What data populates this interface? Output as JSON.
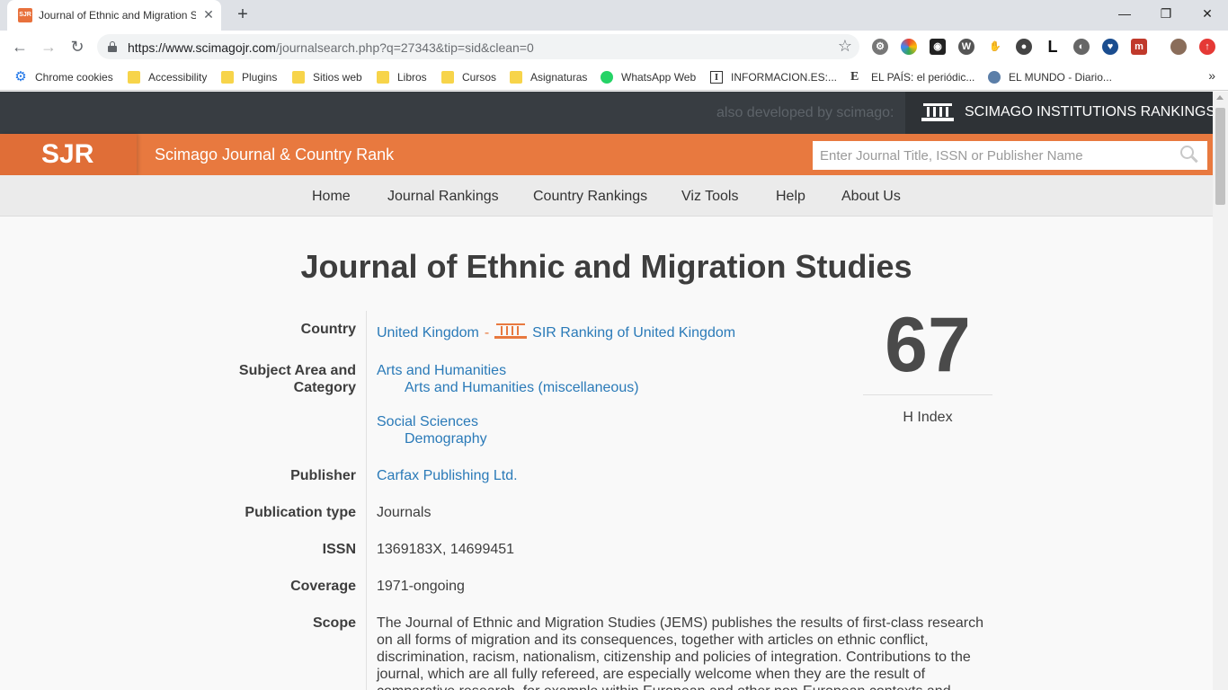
{
  "browser": {
    "tab_title": "Journal of Ethnic and Migration S",
    "tab_favicon": "SJR",
    "url_host": "https://www.scimagojr.com",
    "url_path": "/journalsearch.php?q=27343&tip=sid&clean=0",
    "bookmarks": [
      {
        "label": "Chrome cookies",
        "icon": "gear-icon"
      },
      {
        "label": "Accessibility",
        "icon": "folder-icon"
      },
      {
        "label": "Plugins",
        "icon": "folder-icon"
      },
      {
        "label": "Sitios web",
        "icon": "folder-icon"
      },
      {
        "label": "Libros",
        "icon": "folder-icon"
      },
      {
        "label": "Cursos",
        "icon": "folder-icon"
      },
      {
        "label": "Asignaturas",
        "icon": "folder-icon"
      },
      {
        "label": "WhatsApp Web",
        "icon": "whatsapp-icon"
      },
      {
        "label": "INFORMACION.ES:...",
        "icon": "informacion-icon"
      },
      {
        "label": "EL PAÍS: el periódic...",
        "icon": "elpais-icon"
      },
      {
        "label": "EL MUNDO - Diario...",
        "icon": "globe-icon"
      }
    ],
    "bookmarks_more": "»",
    "profile_letter": "L"
  },
  "site": {
    "also_developed": "also developed by scimago:",
    "sir_label": "SCIMAGO INSTITUTIONS RANKINGS",
    "logo": "SJR",
    "title": "Scimago Journal & Country Rank",
    "search_placeholder": "Enter Journal Title, ISSN or Publisher Name",
    "menu": [
      "Home",
      "Journal Rankings",
      "Country Rankings",
      "Viz Tools",
      "Help",
      "About Us"
    ]
  },
  "journal": {
    "title": "Journal of Ethnic and Migration Studies",
    "labels": {
      "country": "Country",
      "subject_line1": "Subject Area and",
      "subject_line2": "Category",
      "publisher": "Publisher",
      "publication_type": "Publication type",
      "issn": "ISSN",
      "coverage": "Coverage",
      "scope": "Scope"
    },
    "country": "United Kingdom",
    "country_sep": "-",
    "sir_country_link": "SIR Ranking of United Kingdom",
    "subject_areas": [
      {
        "area": "Arts and Humanities",
        "category": "Arts and Humanities (miscellaneous)"
      },
      {
        "area": "Social Sciences",
        "category": "Demography"
      }
    ],
    "publisher": "Carfax Publishing Ltd.",
    "publication_type": "Journals",
    "issn": "1369183X, 14699451",
    "coverage": "1971-ongoing",
    "scope": "The Journal of Ethnic and Migration Studies (JEMS) publishes the results of first-class research on all forms of migration and its consequences, together with articles on ethnic conflict, discrimination, racism, nationalism, citizenship and policies of integration. Contributions to the journal, which are all fully refereed, are especially welcome when they are the result of comparative research, for example within European and other non-European contexts and",
    "h_index": "67",
    "h_index_label": "H Index"
  },
  "colors": {
    "orange": "#e8793f",
    "dark_bar": "#383d42",
    "link": "#2a7ab8"
  }
}
